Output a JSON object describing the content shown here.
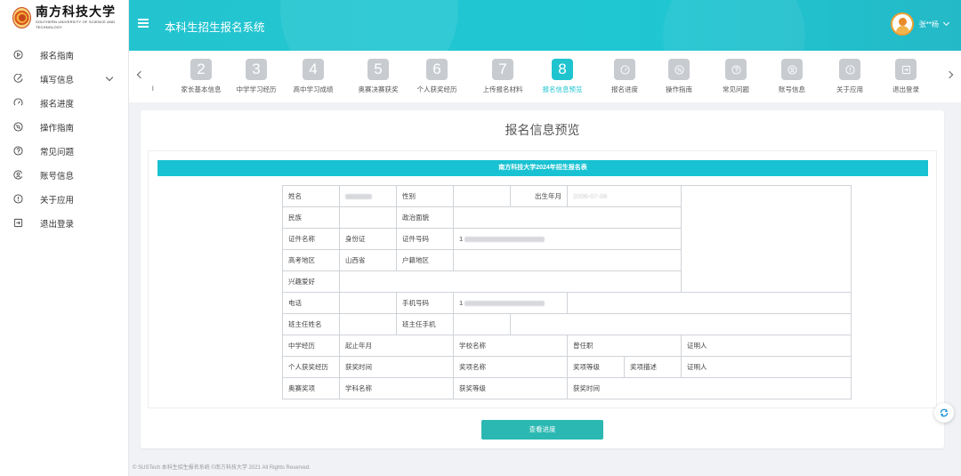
{
  "brand": {
    "name_cn": "南方科技大学",
    "name_en": "SOUTHERN UNIVERSITY OF SCIENCE AND TECHNOLOGY"
  },
  "header": {
    "title": "本科生招生报名系统",
    "user_name": "张**杨"
  },
  "sidebar": {
    "items": [
      {
        "label": "报名指南",
        "icon": "play-circle-icon"
      },
      {
        "label": "填写信息",
        "icon": "edit-icon",
        "expandable": true
      },
      {
        "label": "报名进度",
        "icon": "gauge-icon"
      },
      {
        "label": "操作指南",
        "icon": "compass-icon"
      },
      {
        "label": "常见问题",
        "icon": "question-icon"
      },
      {
        "label": "账号信息",
        "icon": "user-circle-icon"
      },
      {
        "label": "关于应用",
        "icon": "info-icon"
      },
      {
        "label": "退出登录",
        "icon": "logout-icon"
      }
    ]
  },
  "steps": {
    "partial_label": "l",
    "items": [
      {
        "num": "2",
        "label": "家长基本信息"
      },
      {
        "num": "3",
        "label": "中学学习经历"
      },
      {
        "num": "4",
        "label": "高中学习成绩"
      },
      {
        "num": "5",
        "label": "奥赛决赛获奖"
      },
      {
        "num": "6",
        "label": "个人获奖经历"
      },
      {
        "num": "7",
        "label": "上传报名材料"
      },
      {
        "num": "8",
        "label": "报名信息预览",
        "active": true
      },
      {
        "num": "",
        "label": "报名进度",
        "icon": "gauge-icon"
      },
      {
        "num": "",
        "label": "操作指南",
        "icon": "compass-icon"
      },
      {
        "num": "",
        "label": "常见问题",
        "icon": "question-icon",
        "highlight": true
      },
      {
        "num": "",
        "label": "账号信息",
        "icon": "user-circle-icon"
      },
      {
        "num": "",
        "label": "关于应用",
        "icon": "info-icon"
      },
      {
        "num": "",
        "label": "退出登录",
        "icon": "logout-icon"
      }
    ]
  },
  "main": {
    "heading": "报名信息预览",
    "banner": "南方科技大学2024年招生报名表",
    "form": {
      "name_label": "姓名",
      "gender_label": "性别",
      "birth_label": "出生年月",
      "birth_value": "2006-07-06",
      "ethnic_label": "民族",
      "political_label": "政治面貌",
      "idtype_label": "证件名称",
      "idtype_value": "身份证",
      "idnum_label": "证件号码",
      "idnum_value": "1",
      "region_label": "高考地区",
      "region_value": "山西省",
      "hukou_label": "户籍地区",
      "hobby_label": "兴趣爱好",
      "phone_label": "电话",
      "mobile_label": "手机号码",
      "mobile_value": "1",
      "teacher_label": "班主任姓名",
      "teacher_phone_label": "班主任手机",
      "edu": {
        "label": "中学经历",
        "c1": "起止年月",
        "c2": "学校名称",
        "c3": "曾任职",
        "c4": "证明人"
      },
      "awards": {
        "label": "个人获奖经历",
        "c1": "获奖时间",
        "c2": "奖项名称",
        "c3": "奖项等级",
        "c4": "奖项描述",
        "c5": "证明人"
      },
      "olympiad": {
        "label": "奥赛奖项",
        "c1": "学科名称",
        "c2": "获奖等级",
        "c3": "获奖时间"
      }
    },
    "button": "查看进度"
  },
  "footer": "© SUSTech 本科生招生报名系统 ©南方科技大学 2021 All Rights Reserved."
}
